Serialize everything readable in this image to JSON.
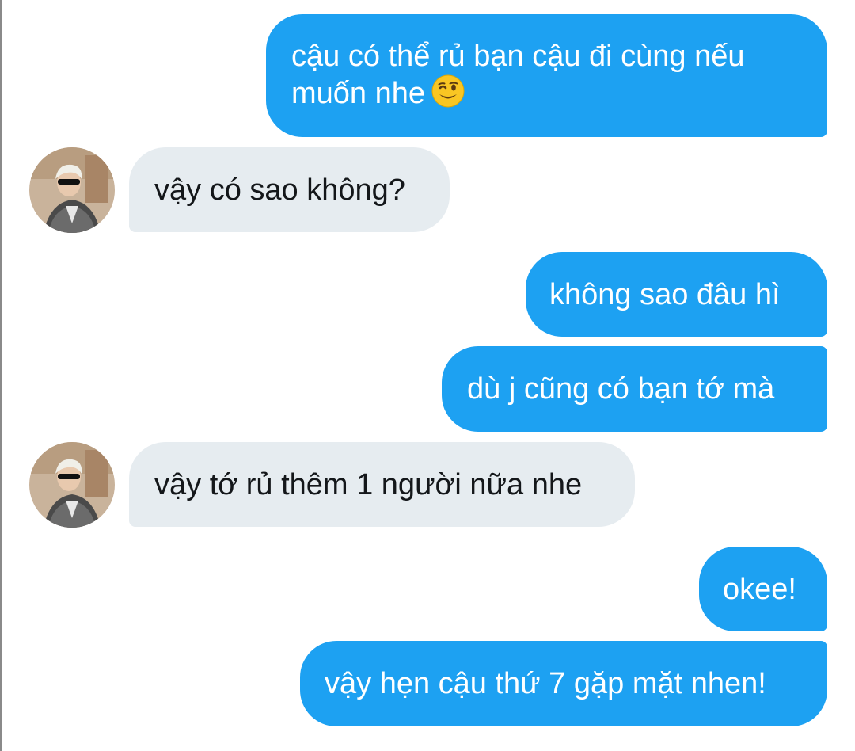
{
  "conversation": {
    "messages": [
      {
        "side": "sent",
        "text": "cậu có thể rủ bạn cậu đi cùng nếu",
        "text2": "muốn nhe",
        "emoji": "winking-face-icon"
      },
      {
        "side": "received",
        "text": "vậy có sao không?",
        "avatar": "contact-avatar"
      },
      {
        "side": "sent",
        "text": "không sao đâu hì"
      },
      {
        "side": "sent",
        "text": "dù j cũng có bạn tớ mà"
      },
      {
        "side": "received",
        "text": "vậy tớ rủ thêm 1 người nữa nhe",
        "avatar": "contact-avatar"
      },
      {
        "side": "sent",
        "text": "okee!"
      },
      {
        "side": "sent",
        "text": "vậy hẹn cậu thứ 7 gặp mặt nhen!"
      }
    ]
  },
  "colors": {
    "sent_bubble": "#1da1f2",
    "received_bubble": "#e6ecf0",
    "sent_text": "#ffffff",
    "received_text": "#14171a"
  }
}
